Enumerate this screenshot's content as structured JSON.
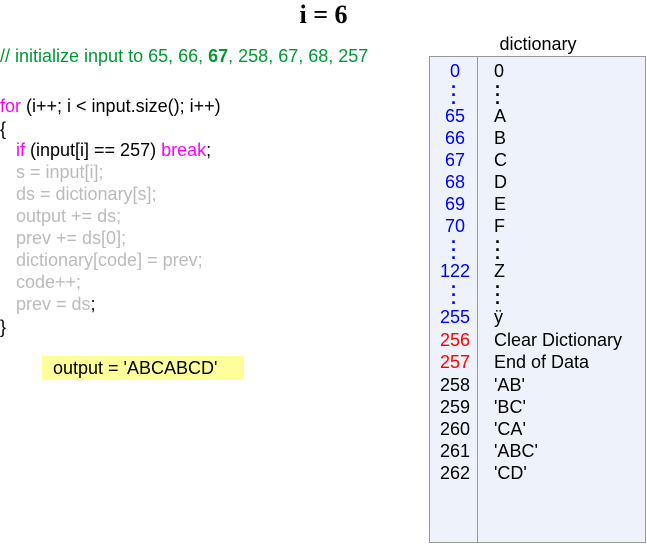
{
  "title": "i = 6",
  "comment": {
    "prefix": "// initialize input to 65, 66, ",
    "bold": "67",
    "suffix": ", 258, 67, 68, 257"
  },
  "code": {
    "for_kw": "for",
    "for_rest": " (i++; i < input.size(); i++)",
    "open_brace": "{",
    "if_kw": "if",
    "if_rest": " (input[i] == 257) ",
    "break_kw": "break",
    "if_semicolon": ";",
    "gray_lines": [
      "s = input[i];",
      "ds = dictionary[s];",
      "output += ds;",
      "prev += ds[0];",
      "dictionary[code] = prev;",
      "code++;"
    ],
    "last_gray": "prev = ds",
    "last_black": ";",
    "close_brace": "}"
  },
  "output": "output = 'ABCABCD'",
  "dictionary": {
    "title": "dictionary",
    "rows": [
      {
        "key": "0",
        "val": "0",
        "color": "#0000ff"
      },
      {
        "key": "65",
        "val": "A",
        "color": "#0000ff"
      },
      {
        "key": "66",
        "val": "B",
        "color": "#0000ff"
      },
      {
        "key": "67",
        "val": "C",
        "color": "#0000ff"
      },
      {
        "key": "68",
        "val": "D",
        "color": "#0000ff"
      },
      {
        "key": "69",
        "val": "E",
        "color": "#0000ff"
      },
      {
        "key": "70",
        "val": "F",
        "color": "#0000ff"
      },
      {
        "key": "122",
        "val": "Z",
        "color": "#0000ff"
      },
      {
        "key": "255",
        "val": "ÿ",
        "color": "#0000ff"
      },
      {
        "key": "256",
        "val": "Clear Dictionary",
        "color": "#ff0000"
      },
      {
        "key": "257",
        "val": "End of Data",
        "color": "#ff0000"
      },
      {
        "key": "258",
        "val": "'AB'",
        "color": "#000000"
      },
      {
        "key": "259",
        "val": "'BC'",
        "color": "#000000"
      },
      {
        "key": "260",
        "val": "'CA'",
        "color": "#000000"
      },
      {
        "key": "261",
        "val": "'ABC'",
        "color": "#000000"
      },
      {
        "key": "262",
        "val": "'CD'",
        "color": "#000000"
      }
    ]
  }
}
